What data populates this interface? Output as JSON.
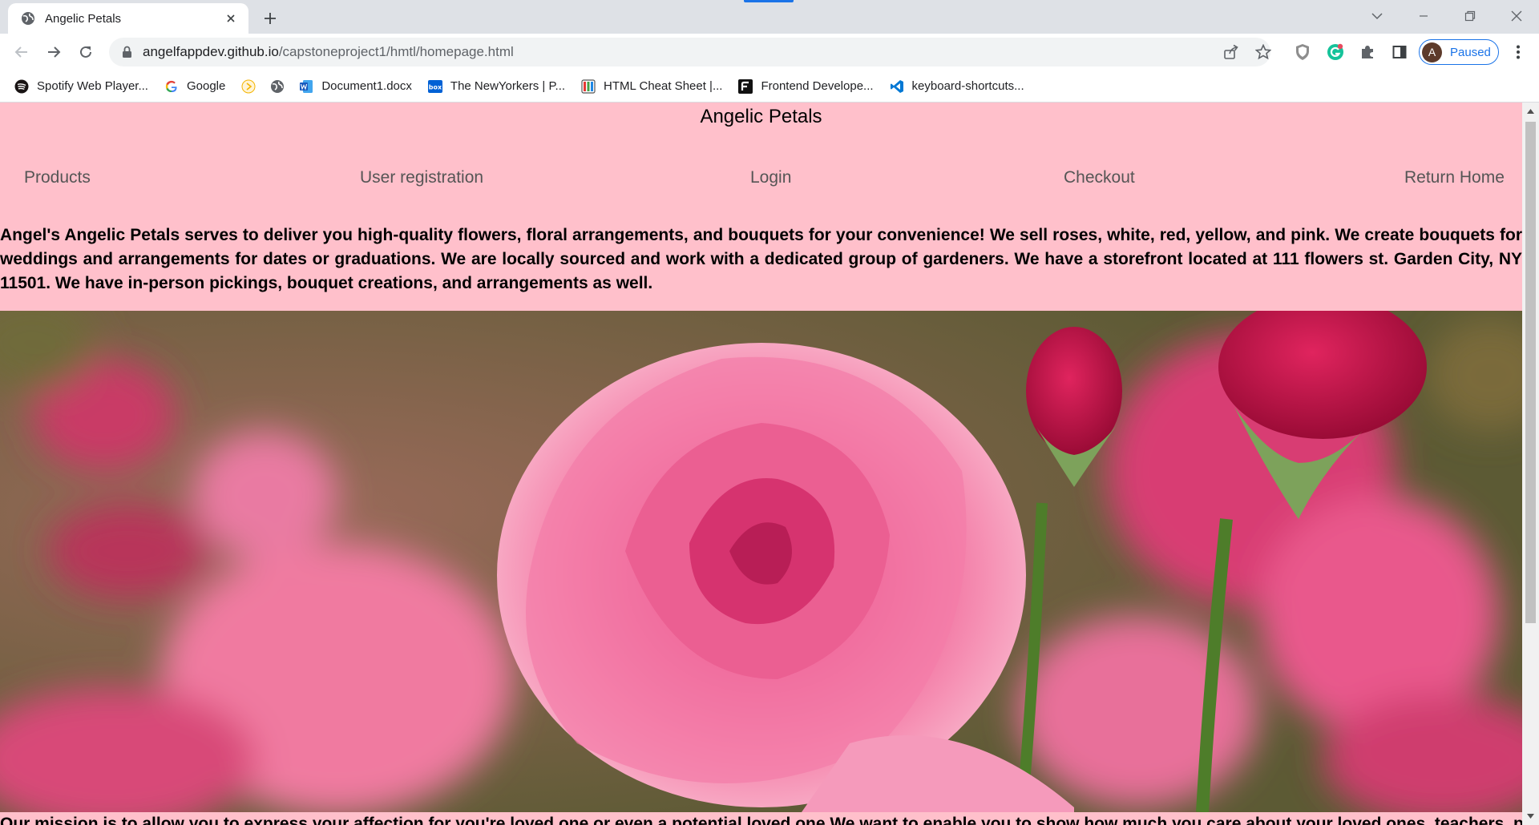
{
  "browser": {
    "tab": {
      "title": "Angelic Petals"
    },
    "address": {
      "host": "angelfappdev.github.io",
      "path": "/capstoneproject1/hmtl/homepage.html"
    },
    "profile": {
      "initial": "A",
      "status": "Paused"
    },
    "bookmarks": [
      {
        "label": "Spotify Web Player...",
        "icon": "spotify-icon"
      },
      {
        "label": "Google",
        "icon": "google-icon"
      },
      {
        "label": "",
        "icon": "bookmark-app-icon"
      },
      {
        "label": "",
        "icon": "globe-icon"
      },
      {
        "label": "Document1.docx",
        "icon": "word-icon"
      },
      {
        "label": "The NewYorkers | P...",
        "icon": "box-icon"
      },
      {
        "label": "HTML Cheat Sheet |...",
        "icon": "cheatsheet-icon"
      },
      {
        "label": "Frontend Develope...",
        "icon": "frontend-icon"
      },
      {
        "label": "keyboard-shortcuts...",
        "icon": "vscode-icon"
      }
    ],
    "colors": {
      "accent": "#1a73e8",
      "page_bg": "#ffc0cb"
    }
  },
  "page": {
    "title": "Angelic Petals",
    "nav": {
      "products": "Products",
      "register": "User registration",
      "login": "Login",
      "checkout": "Checkout",
      "home": "Return Home"
    },
    "intro": "Angel's Angelic Petals serves to deliver you high-quality flowers, floral arrangements, and bouquets for your convenience! We sell roses, white, red, yellow, and pink. We create bouquets for weddings and arrangements for dates or graduations. We are locally sourced and work with a dedicated group of gardeners. We have a storefront located at 111 flowers st. Garden City, NY 11501. We have in-person pickings, bouquet creations, and arrangements as well.",
    "mission": "Our mission is to allow you to express your affection for you're loved one or even a potential loved one We want to enable you to show how much you care about your loved ones, teachers, partners"
  }
}
